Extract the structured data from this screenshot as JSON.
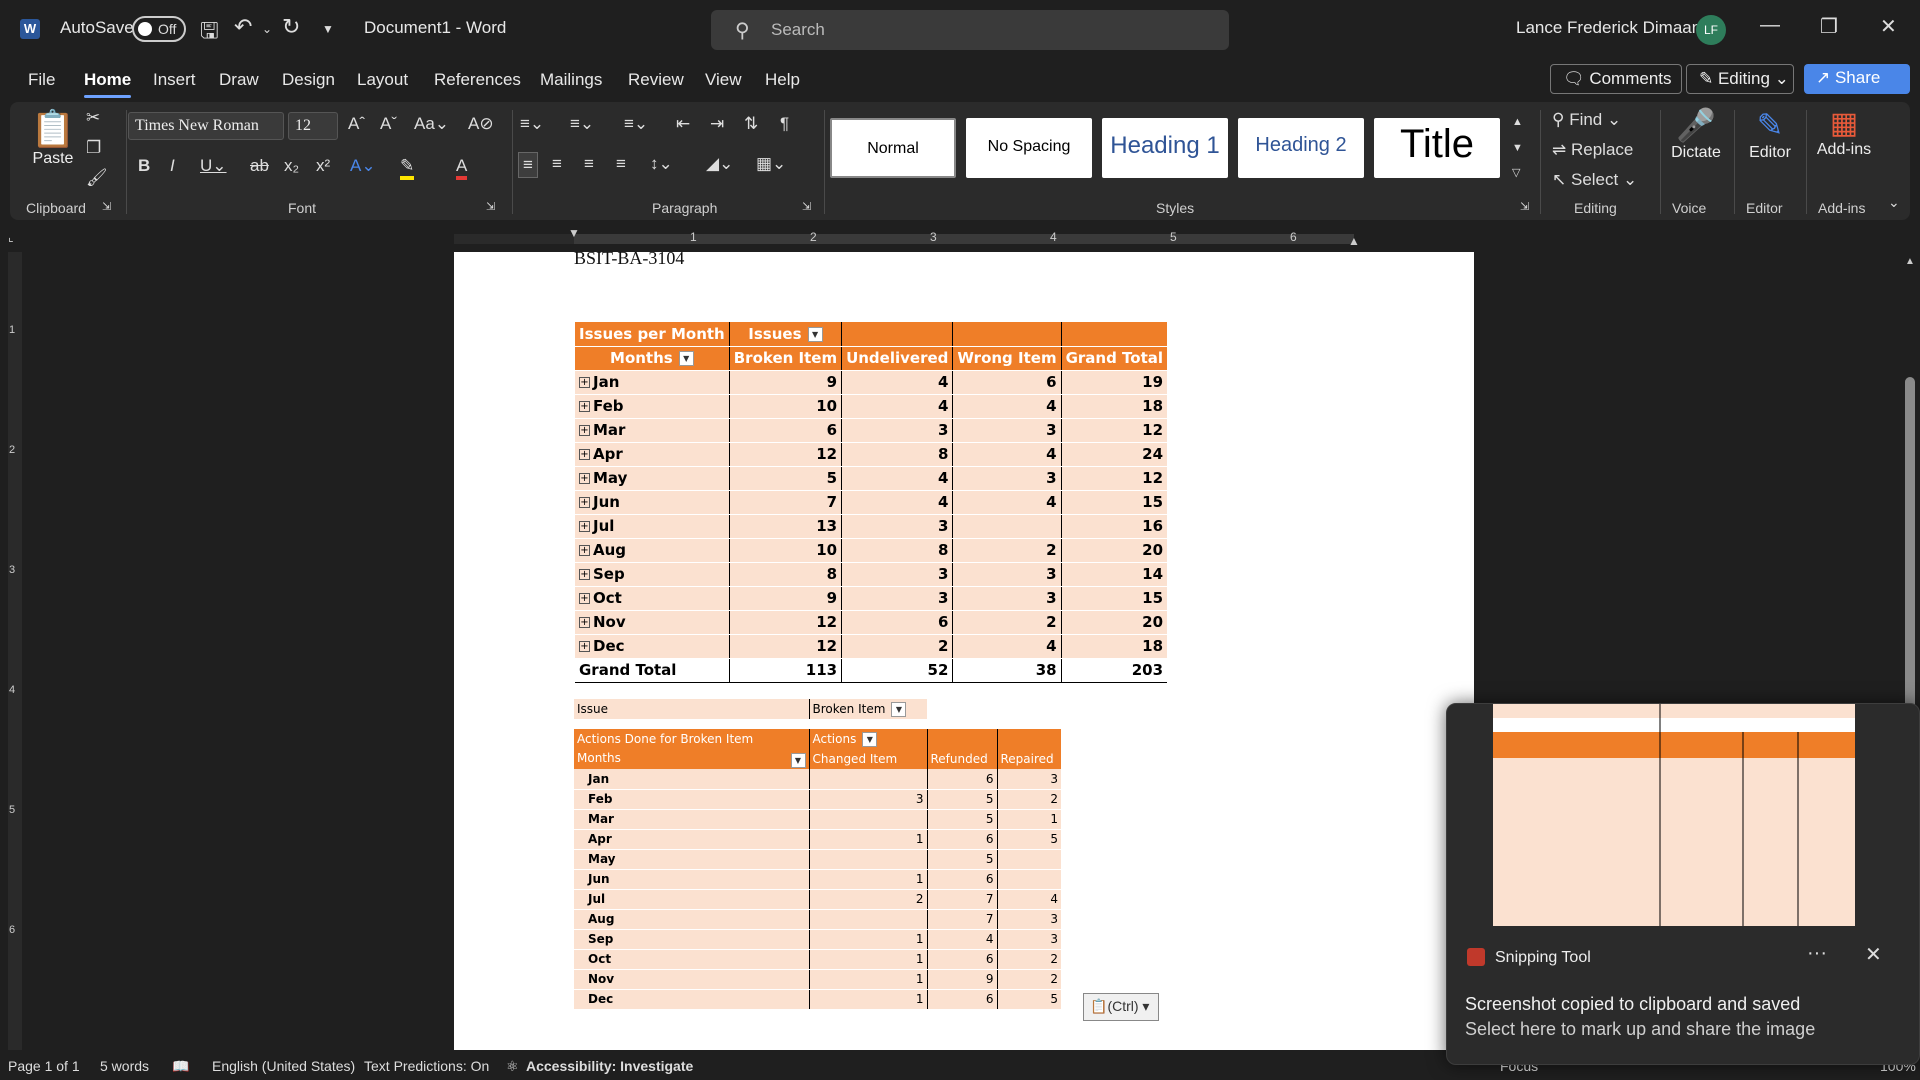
{
  "titlebar": {
    "autosave_label": "AutoSave",
    "toggle_state": "Off",
    "doc_title": "Document1  -  Word",
    "search_placeholder": "Search",
    "user_name": "Lance Frederick Dimaano",
    "user_initials": "LF"
  },
  "menu": {
    "items": [
      "File",
      "Home",
      "Insert",
      "Draw",
      "Design",
      "Layout",
      "References",
      "Mailings",
      "Review",
      "View",
      "Help"
    ],
    "active": "Home",
    "comments": "Comments",
    "editing": "Editing",
    "share": "Share"
  },
  "ribbon": {
    "clipboard": {
      "paste": "Paste",
      "label": "Clipboard"
    },
    "font": {
      "name": "Times New Roman",
      "size": "12",
      "label": "Font"
    },
    "paragraph": {
      "label": "Paragraph"
    },
    "styles": {
      "items": [
        "Normal",
        "No Spacing",
        "Heading 1",
        "Heading 2",
        "Title"
      ],
      "label": "Styles"
    },
    "editing": {
      "find": "Find",
      "replace": "Replace",
      "select": "Select",
      "label": "Editing"
    },
    "voice": {
      "dictate": "Dictate",
      "label": "Voice"
    },
    "editor": {
      "editor": "Editor",
      "label": "Editor"
    },
    "addins": {
      "addins": "Add-ins",
      "label": "Add-ins"
    }
  },
  "ruler": {
    "numbers": [
      "1",
      "2",
      "3",
      "4",
      "5",
      "6"
    ],
    "vnumbers": [
      "1",
      "2",
      "3",
      "4",
      "5",
      "6"
    ]
  },
  "document": {
    "heading": "BSIT-BA-3104",
    "pivot1": {
      "title": "Issues per Month",
      "col_field": "Issues",
      "row_field": "Months",
      "columns": [
        "Broken Item",
        "Undelivered",
        "Wrong Item",
        "Grand Total"
      ],
      "rows": [
        {
          "m": "Jan",
          "a": "9",
          "b": "4",
          "c": "6",
          "t": "19"
        },
        {
          "m": "Feb",
          "a": "10",
          "b": "4",
          "c": "4",
          "t": "18"
        },
        {
          "m": "Mar",
          "a": "6",
          "b": "3",
          "c": "3",
          "t": "12"
        },
        {
          "m": "Apr",
          "a": "12",
          "b": "8",
          "c": "4",
          "t": "24"
        },
        {
          "m": "May",
          "a": "5",
          "b": "4",
          "c": "3",
          "t": "12"
        },
        {
          "m": "Jun",
          "a": "7",
          "b": "4",
          "c": "4",
          "t": "15"
        },
        {
          "m": "Jul",
          "a": "13",
          "b": "3",
          "c": "",
          "t": "16"
        },
        {
          "m": "Aug",
          "a": "10",
          "b": "8",
          "c": "2",
          "t": "20"
        },
        {
          "m": "Sep",
          "a": "8",
          "b": "3",
          "c": "3",
          "t": "14"
        },
        {
          "m": "Oct",
          "a": "9",
          "b": "3",
          "c": "3",
          "t": "15"
        },
        {
          "m": "Nov",
          "a": "12",
          "b": "6",
          "c": "2",
          "t": "20"
        },
        {
          "m": "Dec",
          "a": "12",
          "b": "2",
          "c": "4",
          "t": "18"
        }
      ],
      "total": {
        "label": "Grand Total",
        "a": "113",
        "b": "52",
        "c": "38",
        "t": "203"
      }
    },
    "pivot2": {
      "filter_label": "Issue",
      "filter_value": "Broken Item",
      "title": "Actions Done for Broken Item",
      "col_field": "Actions",
      "row_field": "Months",
      "columns": [
        "Changed Item",
        "Refunded",
        "Repaired"
      ],
      "rows": [
        {
          "m": "Jan",
          "a": "",
          "b": "6",
          "c": "3"
        },
        {
          "m": "Feb",
          "a": "3",
          "b": "5",
          "c": "2"
        },
        {
          "m": "Mar",
          "a": "",
          "b": "5",
          "c": "1"
        },
        {
          "m": "Apr",
          "a": "1",
          "b": "6",
          "c": "5"
        },
        {
          "m": "May",
          "a": "",
          "b": "5",
          "c": ""
        },
        {
          "m": "Jun",
          "a": "1",
          "b": "6",
          "c": ""
        },
        {
          "m": "Jul",
          "a": "2",
          "b": "7",
          "c": "4"
        },
        {
          "m": "Aug",
          "a": "",
          "b": "7",
          "c": "3"
        },
        {
          "m": "Sep",
          "a": "1",
          "b": "4",
          "c": "3"
        },
        {
          "m": "Oct",
          "a": "1",
          "b": "6",
          "c": "2"
        },
        {
          "m": "Nov",
          "a": "1",
          "b": "9",
          "c": "2"
        },
        {
          "m": "Dec",
          "a": "1",
          "b": "6",
          "c": "5"
        }
      ]
    },
    "paste_options": "(Ctrl)"
  },
  "statusbar": {
    "page": "Page 1 of 1",
    "words": "5 words",
    "language": "English (United States)",
    "predictions": "Text Predictions: On",
    "accessibility": "Accessibility: Investigate",
    "focus": "Focus",
    "zoom": "100%"
  },
  "toast": {
    "app": "Snipping Tool",
    "more": "···",
    "line1": "Screenshot copied to clipboard and saved",
    "line2": "Select here to mark up and share the image"
  }
}
